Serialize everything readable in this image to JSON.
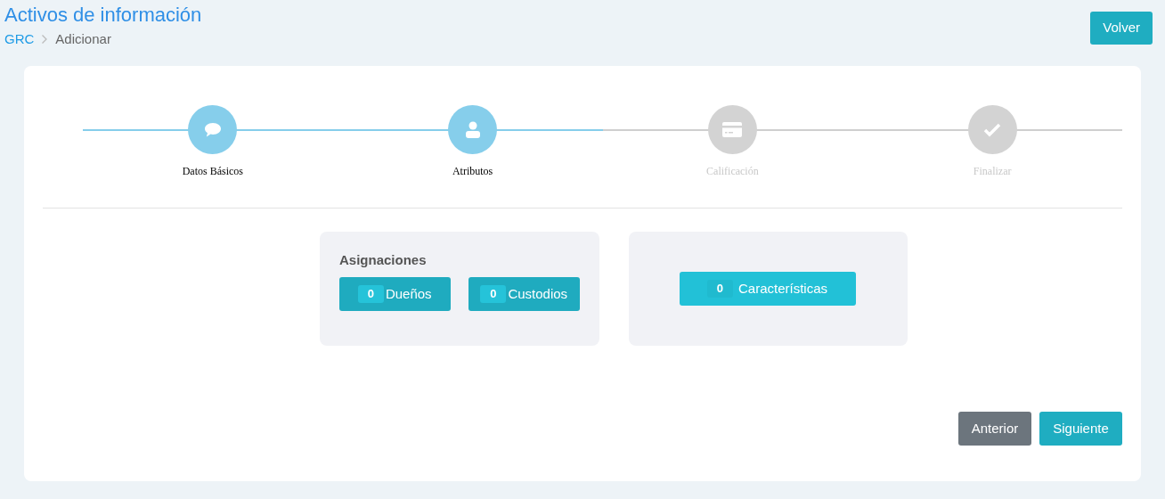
{
  "header": {
    "title": "Activos de información",
    "breadcrumb": [
      {
        "label": "GRC",
        "kind": "link"
      },
      {
        "label": "Adicionar",
        "kind": "current"
      }
    ],
    "back_button": "Volver"
  },
  "steps": [
    {
      "label": "Datos Básicos",
      "kind": "chat",
      "completed": true
    },
    {
      "label": "Atributos",
      "kind": "user",
      "completed": true
    },
    {
      "label": "Calificación",
      "kind": "card",
      "completed": false
    },
    {
      "label": "Finalizar",
      "kind": "check",
      "completed": false
    }
  ],
  "assignments": {
    "title": "Asignaciones",
    "buttons": [
      {
        "count": "0",
        "label": "Dueños"
      },
      {
        "count": "0",
        "label": "Custodios"
      }
    ]
  },
  "characteristics": {
    "count": "0",
    "label": "Características"
  },
  "footer_buttons": [
    {
      "label": "Anterior",
      "kind": "secondary"
    },
    {
      "label": "Siguiente",
      "kind": "primary"
    }
  ]
}
